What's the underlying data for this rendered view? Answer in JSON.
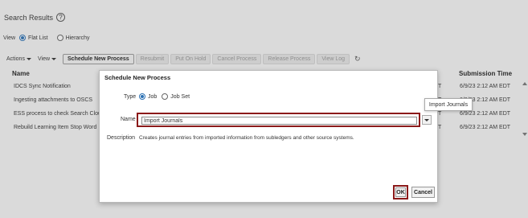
{
  "page": {
    "title": "Search Results",
    "view_label": "View",
    "view_options": [
      "Flat List",
      "Hierarchy"
    ],
    "view_selected": "Flat List"
  },
  "toolbar": {
    "actions_label": "Actions",
    "view_label": "View",
    "buttons": [
      "Schedule New Process",
      "Resubmit",
      "Put On Hold",
      "Cancel Process",
      "Release Process",
      "View Log"
    ]
  },
  "table": {
    "columns": [
      "Name",
      "Submission Time"
    ],
    "rows": [
      {
        "name": "IDCS Sync Notification",
        "status": "T",
        "time": "6/9/23 2:12 AM EDT"
      },
      {
        "name": "Ingesting attachments to OSCS",
        "status": "T",
        "time": "6/9/23 2:12 AM EDT"
      },
      {
        "name": "ESS process to check Search Cloud",
        "status": "T",
        "time": "6/9/23 2:12 AM EDT"
      },
      {
        "name": "Rebuild Learning Item Stop Word In",
        "status": "T",
        "time": "6/9/23 2:12 AM EDT"
      }
    ]
  },
  "dialog": {
    "title": "Schedule New Process",
    "type_label": "Type",
    "type_options": [
      "Job",
      "Job Set"
    ],
    "type_selected": "Job",
    "name_label": "Name",
    "name_value": "Import Journals",
    "tooltip": "Import Journals",
    "description_label": "Description",
    "description_value": "Creates journal entries from imported information from subledgers and other source systems.",
    "ok_label": "OK",
    "cancel_label": "Cancel"
  },
  "colors": {
    "highlight": "#8b1a1a",
    "radio_selected": "#2a6fb3"
  }
}
